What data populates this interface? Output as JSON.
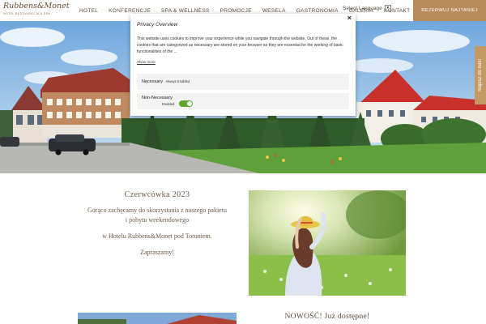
{
  "header": {
    "logo_main": "Rubbens&Monet",
    "logo_sub": "HOTEL RESTAURACJA & SPA",
    "nav": [
      "HOTEL",
      "KONFERENCJE",
      "SPA & WELLNESS",
      "PROMOCJE",
      "WESELA",
      "GASTRONOMIA",
      "GALERIA",
      "KONTAKT"
    ],
    "language": "Select Language",
    "cta": "REZERWUJ NAJTANIEJ"
  },
  "side_tab": "Napisz do nas!",
  "cookie_modal": {
    "title": "Privacy Overview",
    "body": "This website uses cookies to improve your experience while you navigate through the website. Out of these, the cookies that are categorized as necessary are stored on your browser as they are essential for the working of basic functionalities of the ...",
    "show_more": "Show more",
    "necessary_label": "Necessary",
    "necessary_status": "Always Enabled",
    "nonnecessary_label": "Non-Necessary",
    "nonnecessary_status": "Enabled",
    "nonnecessary_enabled": true,
    "close": "×"
  },
  "promo": {
    "title": "Czerwcówka   2023",
    "line1": "Gorąco zachęcamy do skorzystania z naszego pakietu",
    "line2": "i pobytu weekendowego",
    "line3": "w Hotelu Rubbens&Monet pod Toruniem.",
    "line4": "Zapraszamy!"
  },
  "bottom": {
    "title": "NOWOŚĆ! Już dostępne!"
  },
  "colors": {
    "brand": "#b98a5a",
    "side_tab": "#c49a64",
    "toggle_on": "#61a229",
    "text_brown": "#6b5a48"
  }
}
